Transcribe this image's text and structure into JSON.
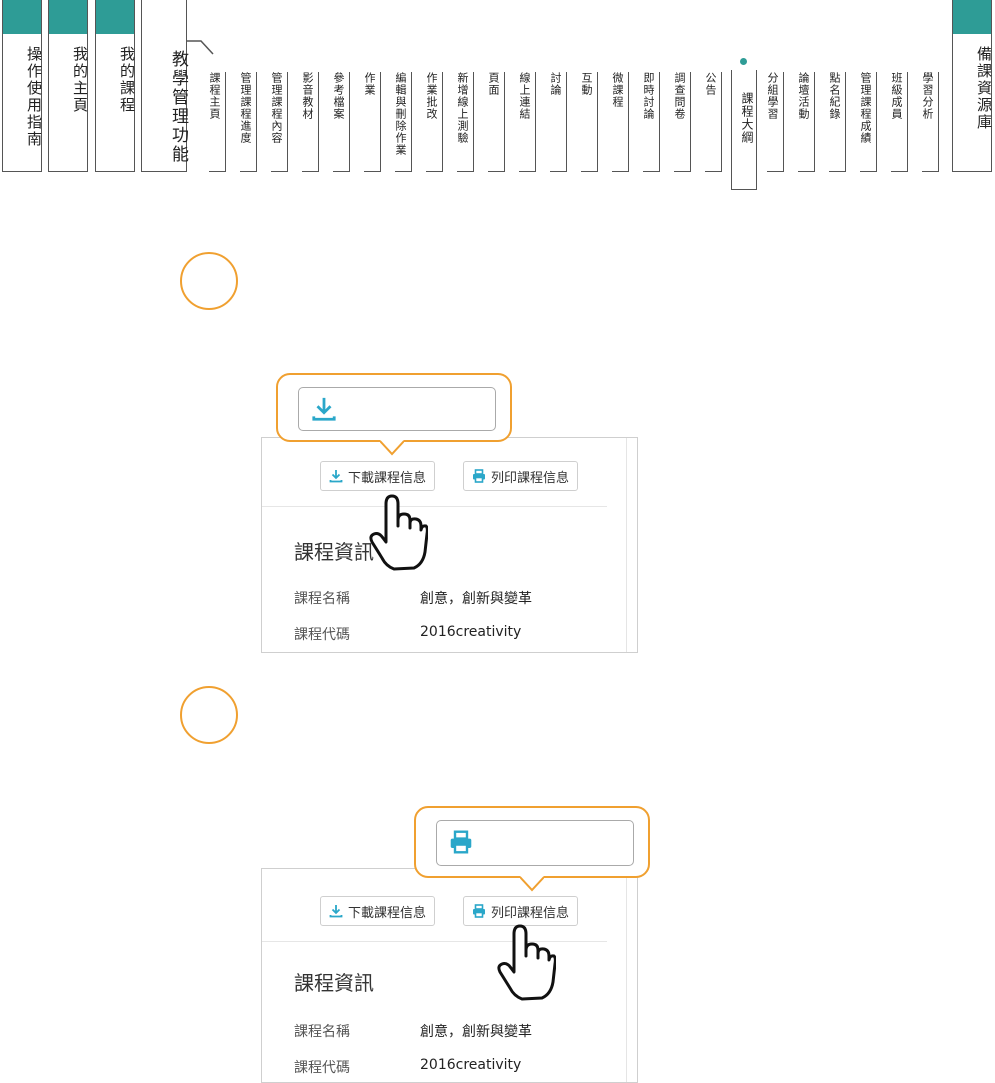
{
  "nav": {
    "left_tabs": [
      {
        "label": "操作使用指南"
      },
      {
        "label": "我的主頁"
      },
      {
        "label": "我的課程"
      },
      {
        "label": "教學管理功能"
      }
    ],
    "sub_items": [
      "課程主頁",
      "管理課程進度",
      "管理課程內容",
      "影音教材",
      "參考檔案",
      "作業",
      "編輯與刪除作業",
      "作業批改",
      "新增線上測驗",
      "頁面",
      "線上連結",
      "討論",
      "互動",
      "微課程",
      "即時討論",
      "調查問卷",
      "公告",
      "課程大綱",
      "分組學習",
      "論壇活動",
      "點名紀錄",
      "管理課程成績",
      "班級成員",
      "學習分析"
    ],
    "active_item": "課程大綱",
    "right_tab": {
      "label": "備課資源庫"
    },
    "accent_color": "#2e9c96"
  },
  "steps": [
    {
      "callout_icon": "download-icon",
      "panel": {
        "download_button": "下載課程信息",
        "print_button": "列印課程信息",
        "section_title": "課程資訊",
        "rows": [
          {
            "label": "課程名稱",
            "value": "創意，創新與變革"
          },
          {
            "label": "課程代碼",
            "value": "2016creativity"
          }
        ]
      }
    },
    {
      "callout_icon": "printer-icon",
      "panel": {
        "download_button": "下載課程信息",
        "print_button": "列印課程信息",
        "section_title": "課程資訊",
        "rows": [
          {
            "label": "課程名稱",
            "value": "創意，創新與變革"
          },
          {
            "label": "課程代碼",
            "value": "2016creativity"
          }
        ]
      }
    }
  ],
  "colors": {
    "highlight": "#f0a030",
    "icon": "#2aa7c9"
  }
}
